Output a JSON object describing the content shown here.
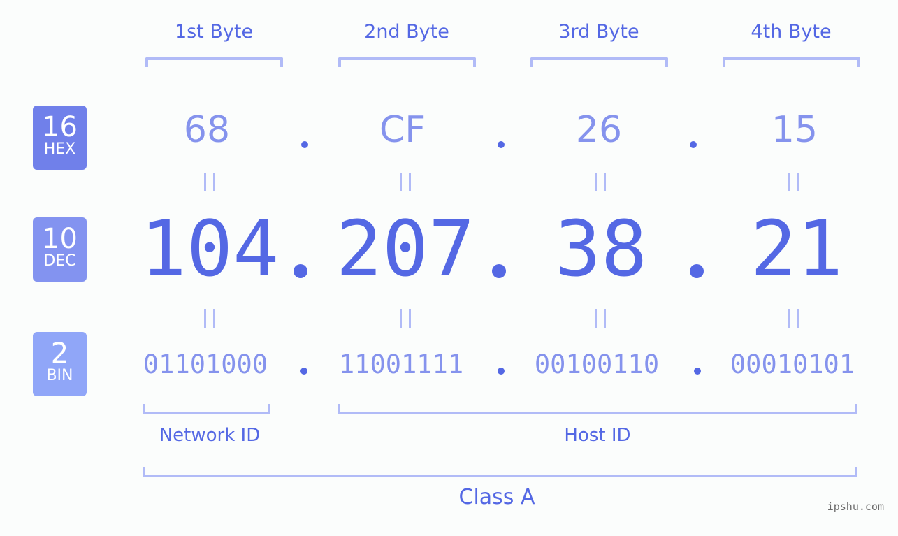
{
  "bytes": {
    "labels": [
      "1st Byte",
      "2nd Byte",
      "3rd Byte",
      "4th Byte"
    ],
    "hex": [
      "68",
      "CF",
      "26",
      "15"
    ],
    "dec": [
      "104",
      "207",
      "38",
      "21"
    ],
    "bin": [
      "01101000",
      "11001111",
      "00100110",
      "00010101"
    ]
  },
  "badges": {
    "hex": {
      "num": "16",
      "label": "HEX",
      "color": "#7080ea"
    },
    "dec": {
      "num": "10",
      "label": "DEC",
      "color": "#8393f0"
    },
    "bin": {
      "num": "2",
      "label": "BIN",
      "color": "#90a6f8"
    }
  },
  "segments": {
    "network": "Network ID",
    "host": "Host ID",
    "class": "Class A"
  },
  "watermark": "ipshu.com",
  "colors": {
    "accent": "#5468e4",
    "light": "#8593ed",
    "bracket": "#b1bbf7"
  }
}
